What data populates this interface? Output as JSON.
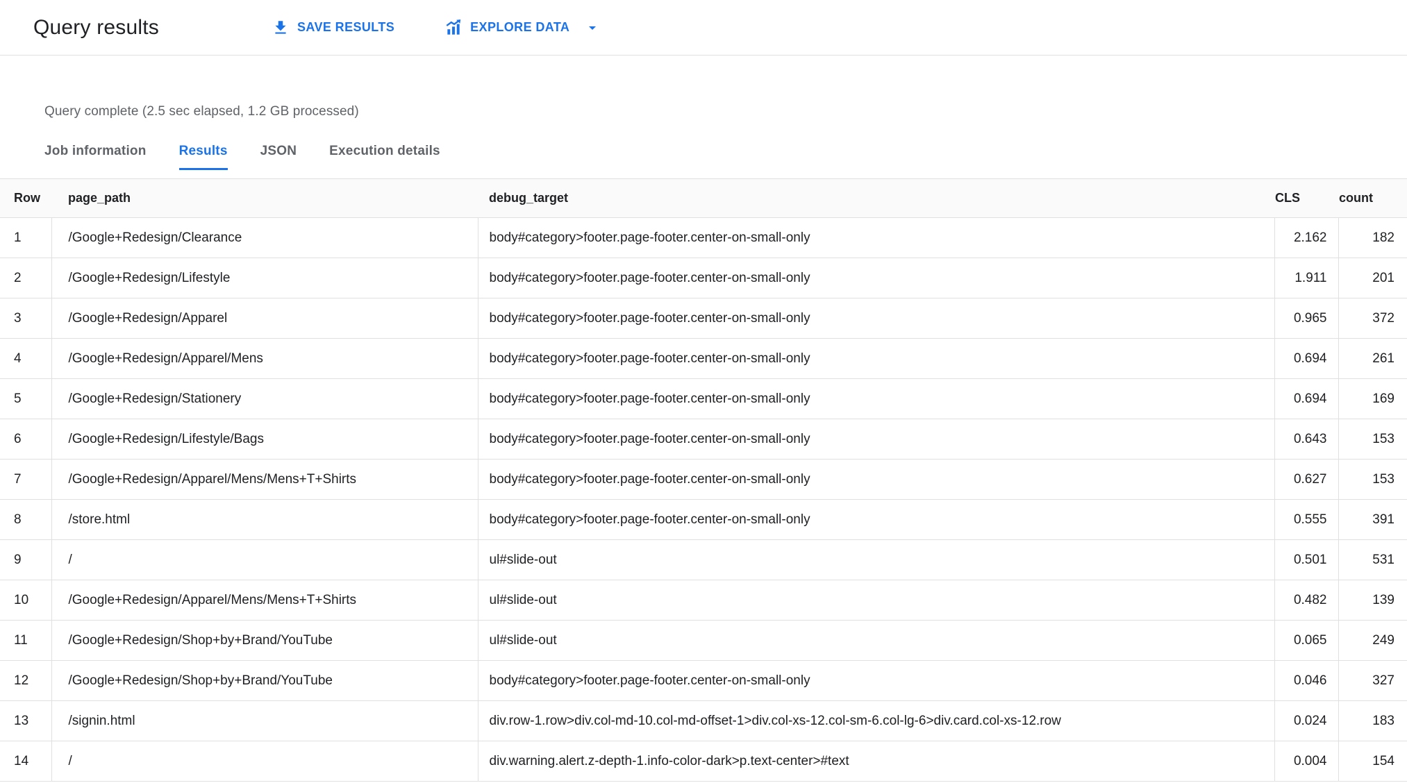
{
  "header": {
    "title": "Query results",
    "save_results_label": "SAVE RESULTS",
    "explore_data_label": "EXPLORE DATA",
    "icons": {
      "save": "download-icon",
      "explore": "bar-chart-icon",
      "explore_caret": "arrow-drop-down-icon"
    }
  },
  "status_text": "Query complete (2.5 sec elapsed, 1.2 GB processed)",
  "tabs": [
    {
      "label": "Job information",
      "active": false
    },
    {
      "label": "Results",
      "active": true
    },
    {
      "label": "JSON",
      "active": false
    },
    {
      "label": "Execution details",
      "active": false
    }
  ],
  "results_table": {
    "columns": [
      "Row",
      "page_path",
      "debug_target",
      "CLS",
      "count"
    ],
    "rows": [
      {
        "row": "1",
        "page_path": "/Google+Redesign/Clearance",
        "debug_target": "body#category>footer.page-footer.center-on-small-only",
        "cls": "2.162",
        "count": "182"
      },
      {
        "row": "2",
        "page_path": "/Google+Redesign/Lifestyle",
        "debug_target": "body#category>footer.page-footer.center-on-small-only",
        "cls": "1.911",
        "count": "201"
      },
      {
        "row": "3",
        "page_path": "/Google+Redesign/Apparel",
        "debug_target": "body#category>footer.page-footer.center-on-small-only",
        "cls": "0.965",
        "count": "372"
      },
      {
        "row": "4",
        "page_path": "/Google+Redesign/Apparel/Mens",
        "debug_target": "body#category>footer.page-footer.center-on-small-only",
        "cls": "0.694",
        "count": "261"
      },
      {
        "row": "5",
        "page_path": "/Google+Redesign/Stationery",
        "debug_target": "body#category>footer.page-footer.center-on-small-only",
        "cls": "0.694",
        "count": "169"
      },
      {
        "row": "6",
        "page_path": "/Google+Redesign/Lifestyle/Bags",
        "debug_target": "body#category>footer.page-footer.center-on-small-only",
        "cls": "0.643",
        "count": "153"
      },
      {
        "row": "7",
        "page_path": "/Google+Redesign/Apparel/Mens/Mens+T+Shirts",
        "debug_target": "body#category>footer.page-footer.center-on-small-only",
        "cls": "0.627",
        "count": "153"
      },
      {
        "row": "8",
        "page_path": "/store.html",
        "debug_target": "body#category>footer.page-footer.center-on-small-only",
        "cls": "0.555",
        "count": "391"
      },
      {
        "row": "9",
        "page_path": "/",
        "debug_target": "ul#slide-out",
        "cls": "0.501",
        "count": "531"
      },
      {
        "row": "10",
        "page_path": "/Google+Redesign/Apparel/Mens/Mens+T+Shirts",
        "debug_target": "ul#slide-out",
        "cls": "0.482",
        "count": "139"
      },
      {
        "row": "11",
        "page_path": "/Google+Redesign/Shop+by+Brand/YouTube",
        "debug_target": "ul#slide-out",
        "cls": "0.065",
        "count": "249"
      },
      {
        "row": "12",
        "page_path": "/Google+Redesign/Shop+by+Brand/YouTube",
        "debug_target": "body#category>footer.page-footer.center-on-small-only",
        "cls": "0.046",
        "count": "327"
      },
      {
        "row": "13",
        "page_path": "/signin.html",
        "debug_target": "div.row-1.row>div.col-md-10.col-md-offset-1>div.col-xs-12.col-sm-6.col-lg-6>div.card.col-xs-12.row",
        "cls": "0.024",
        "count": "183"
      },
      {
        "row": "14",
        "page_path": "/",
        "debug_target": "div.warning.alert.z-depth-1.info-color-dark>p.text-center>#text",
        "cls": "0.004",
        "count": "154"
      }
    ]
  },
  "colors": {
    "accent": "#1a73e8",
    "text": "#202124",
    "muted_text": "#5f6368",
    "border": "#e0e0e0",
    "table_header_bg": "#fafafa"
  }
}
